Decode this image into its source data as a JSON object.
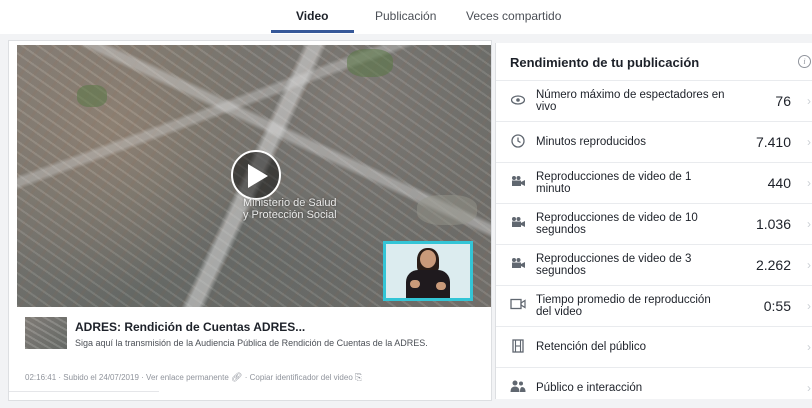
{
  "tabs": [
    {
      "label": "Video",
      "active": true
    },
    {
      "label": "Publicación",
      "active": false
    },
    {
      "label": "Veces compartido",
      "active": false
    }
  ],
  "video": {
    "overlay_line1": "Ministerio de Salud",
    "overlay_line2": "y Protección Social",
    "title": "ADRES: Rendición de Cuentas ADRES...",
    "description": "Siga aquí la transmisión de la Audiencia Pública de Rendición de Cuentas de la ADRES.",
    "duration": "02:16:41",
    "sep": "·",
    "uploaded": "Subido el 24/07/2019",
    "permalink": "Ver enlace permanente",
    "copy_id": "Copiar identificador del video"
  },
  "performance": {
    "title": "Rendimiento de tu publicación",
    "info_icon": "i",
    "metrics": [
      {
        "icon": "eye-icon",
        "label": "Número máximo de espectadores en vivo",
        "value": "76"
      },
      {
        "icon": "clock-icon",
        "label": "Minutos reproducidos",
        "value": "7.410"
      },
      {
        "icon": "camera-icon",
        "label": "Reproducciones de video de 1 minuto",
        "value": "440"
      },
      {
        "icon": "camera-icon",
        "label": "Reproducciones de video de 10 segundos",
        "value": "1.036"
      },
      {
        "icon": "camera-icon",
        "label": "Reproducciones de video de 3 segundos",
        "value": "2.262"
      },
      {
        "icon": "video-icon",
        "label": "Tiempo promedio de reproducción del video",
        "value": "0:55"
      },
      {
        "icon": "film-icon",
        "label": "Retención del público",
        "value": ""
      },
      {
        "icon": "people-icon",
        "label": "Público e interacción",
        "value": ""
      }
    ],
    "chevron": "›"
  },
  "colors": {
    "accent": "#365899",
    "interpreter_border": "#33c5d6",
    "background": "#f2f3f5"
  }
}
